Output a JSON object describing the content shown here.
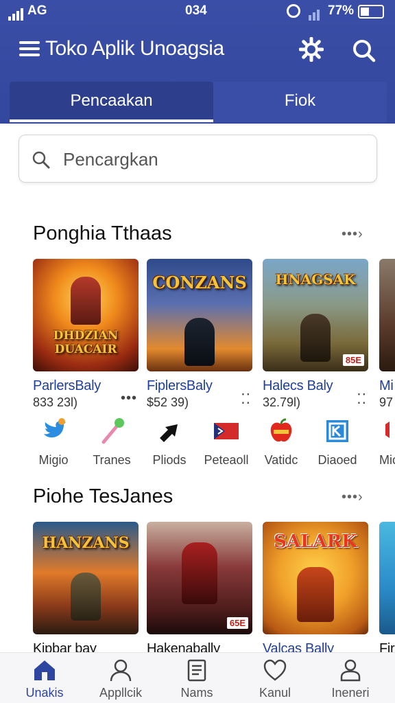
{
  "status_bar": {
    "carrier": "AG",
    "time": "034",
    "battery": "77%"
  },
  "header": {
    "title": "Toko Aplik Unoagsia"
  },
  "tabs": [
    {
      "label": "Pencaakan"
    },
    {
      "label": "Fiok"
    }
  ],
  "search": {
    "placeholder": "Pencargkan"
  },
  "sections": [
    {
      "title": "Ponghia Tthaas",
      "cards": [
        {
          "name": "ParlersBaly",
          "sub": "833 23l)",
          "art": "DHDZIAN DUACAIR",
          "badge": ""
        },
        {
          "name": "FiplersBaly",
          "sub": "$52 39)",
          "art": "CONZANS",
          "badge": ""
        },
        {
          "name": "Halecs Baly",
          "sub": "32.79l)",
          "art": "HNAGSAK",
          "badge": "85E"
        },
        {
          "name": "Mi",
          "sub": "97",
          "art": "",
          "badge": ""
        }
      ]
    },
    {
      "title": "Piohe TesJanes",
      "cards": [
        {
          "name": "Kipbar bay",
          "art": "HANZANS",
          "badge": ""
        },
        {
          "name": "Hakenabally",
          "art": "",
          "badge": "65E"
        },
        {
          "name": "Valcas Bally",
          "art": "SALARK",
          "badge": ""
        },
        {
          "name": "Fir",
          "art": "",
          "badge": ""
        }
      ]
    }
  ],
  "apps": [
    {
      "label": "Migio",
      "icon": "twitter-bird-icon"
    },
    {
      "label": "Tranes",
      "icon": "wand-icon"
    },
    {
      "label": "Pliods",
      "icon": "arrow-icon"
    },
    {
      "label": "Peteaoll",
      "icon": "flag-icon"
    },
    {
      "label": "Vatidc",
      "icon": "apple-icon"
    },
    {
      "label": "Diaoed",
      "icon": "square-k-icon"
    },
    {
      "label": "Mic",
      "icon": "partial-icon"
    }
  ],
  "bottom_nav": [
    {
      "label": "Unakis",
      "icon": "home-icon",
      "active": true
    },
    {
      "label": "Appllcik",
      "icon": "person-icon",
      "active": false
    },
    {
      "label": "Nams",
      "icon": "document-icon",
      "active": false
    },
    {
      "label": "Kanul",
      "icon": "heart-icon",
      "active": false
    },
    {
      "label": "Ineneri",
      "icon": "profile-icon",
      "active": false
    }
  ],
  "colors": {
    "header": "#3a4ea7",
    "tab_active": "#2d3f8c",
    "accent": "#2f46a0",
    "link": "#1f3f9a"
  }
}
